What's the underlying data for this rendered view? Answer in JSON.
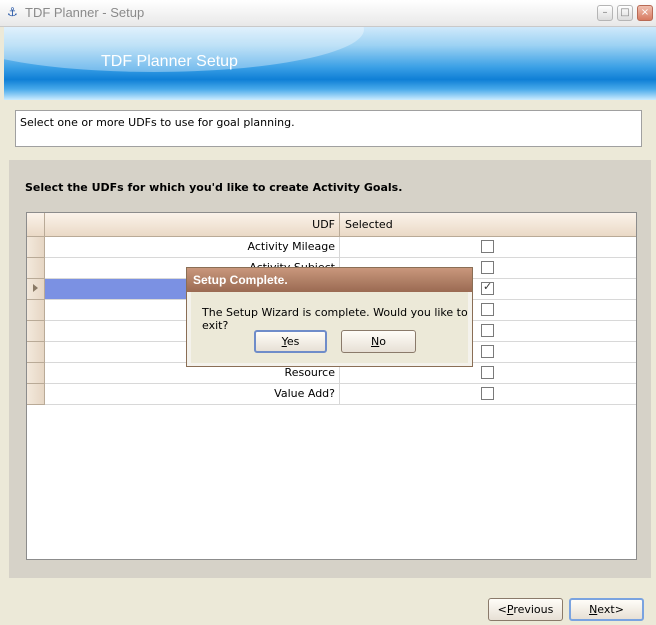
{
  "window": {
    "title": "TDF Planner - Setup"
  },
  "banner": {
    "title": "TDF Planner Setup"
  },
  "instructions": "Select one or more UDFs to use for goal planning.",
  "section_title": "Select the UDFs for which you'd like to create Activity Goals.",
  "grid": {
    "columns": [
      "UDF",
      "Selected"
    ],
    "rows": [
      {
        "udf": "Activity Mileage",
        "selected": false
      },
      {
        "udf": "Activity Subject",
        "selected": false
      },
      {
        "udf": "",
        "selected": true
      },
      {
        "udf": "",
        "selected": false
      },
      {
        "udf": "",
        "selected": false
      },
      {
        "udf": "",
        "selected": false
      },
      {
        "udf": "Resource",
        "selected": false
      },
      {
        "udf": "Value Add?",
        "selected": false
      }
    ]
  },
  "dialog": {
    "title": "Setup Complete.",
    "message": "The Setup Wizard is complete. Would you like to exit?",
    "yes_label": "Yes",
    "no_label": "No"
  },
  "nav": {
    "previous_label": "Previous",
    "next_label": "Next>"
  },
  "colors": {
    "banner_blue": "#0f7fd6",
    "selection": "#7b91e3",
    "dialog_title": "#9a6a52"
  }
}
